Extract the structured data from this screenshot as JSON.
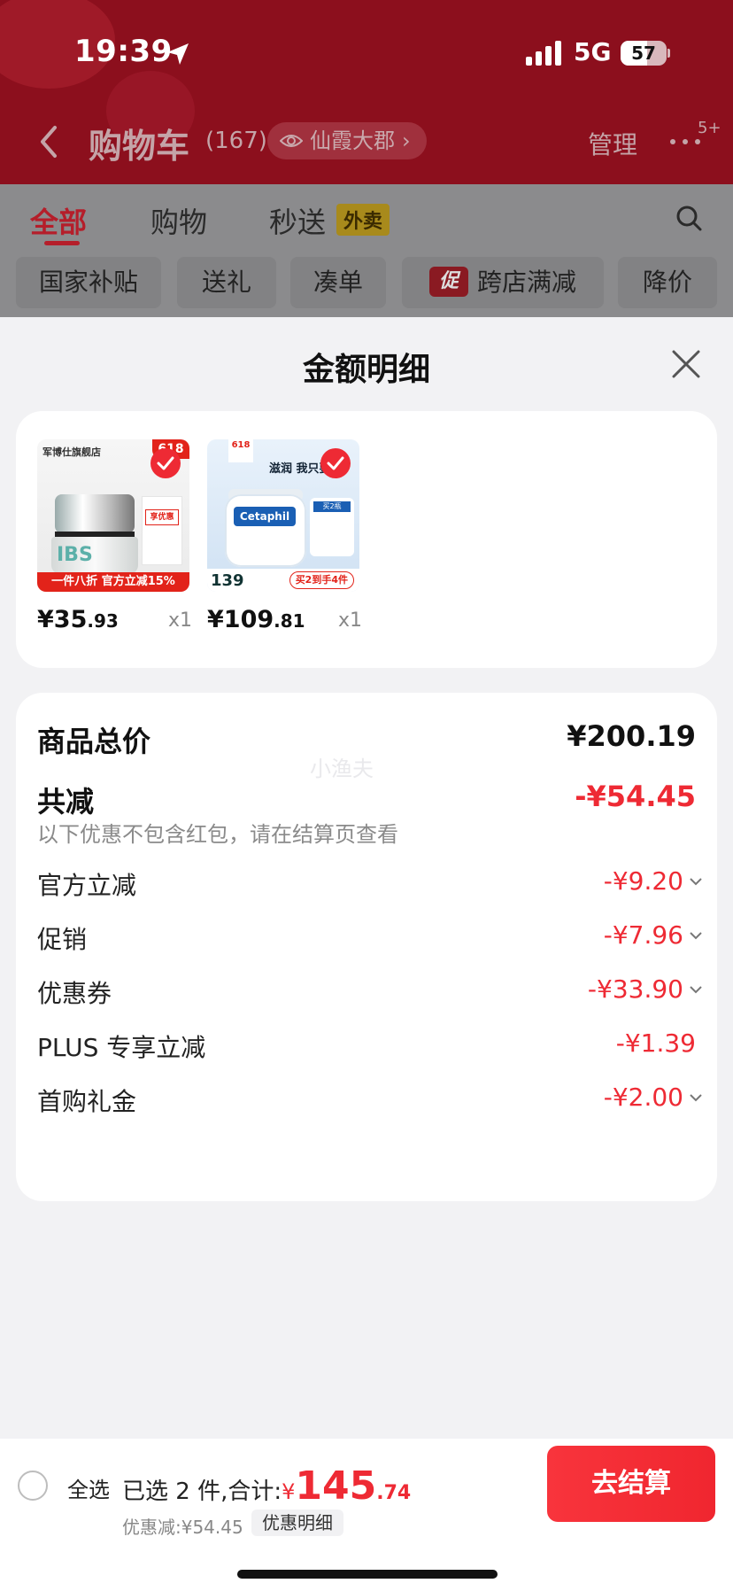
{
  "status_bar": {
    "time": "19:39",
    "network": "5G",
    "battery": "57"
  },
  "nav": {
    "title": "购物车",
    "count": "(167)",
    "address": "仙霞大郡",
    "manage": "管理",
    "badge": "5+"
  },
  "tabs": [
    {
      "label": "全部"
    },
    {
      "label": "购物"
    },
    {
      "label": "秒送"
    }
  ],
  "takeaway_badge": "外卖",
  "filter_chips": [
    {
      "label": "国家补贴"
    },
    {
      "label": "送礼"
    },
    {
      "label": "凑单"
    },
    {
      "label": "跨店满减",
      "icon_text": "促"
    },
    {
      "label": "降价"
    }
  ],
  "sheet": {
    "title": "金额明细",
    "products": [
      {
        "price_int": "¥35",
        "price_dec": ".93",
        "qty": "x1",
        "art": {
          "store": "军博仕旗舰店",
          "badge": "618",
          "box_text": "享优惠",
          "jar_logo": "IBS",
          "strip": "一件八折 官方立减15%"
        }
      },
      {
        "price_int": "¥109",
        "price_dec": ".81",
        "qty": "x1",
        "art": {
          "badge": "618",
          "headline": "滋润 我只要",
          "brand": "Cetaphil",
          "side_tag": "买2瓶",
          "price_tag": "139",
          "buy_tag": "买2到手4件"
        }
      }
    ],
    "details": {
      "total_label": "商品总价",
      "total_value": "¥200.19",
      "reduce_label": "共减",
      "reduce_value": "-¥54.45",
      "note": "以下优惠不包含红包，请在结算页查看",
      "watermark": "小渔夫",
      "items": [
        {
          "label": "官方立减",
          "value": "-¥9.20",
          "expandable": true
        },
        {
          "label": "促销",
          "value": "-¥7.96",
          "expandable": true
        },
        {
          "label": "优惠券",
          "value": "-¥33.90",
          "expandable": true
        },
        {
          "label": "PLUS 专享立减",
          "value": "-¥1.39",
          "expandable": false
        },
        {
          "label": "首购礼金",
          "value": "-¥2.00",
          "expandable": true
        }
      ]
    }
  },
  "bottom_bar": {
    "select_all": "全选",
    "selected_text": "已选 2 件,合计:",
    "total_yen": "¥",
    "total_int": "145",
    "total_dec": ".74",
    "discount": "优惠减:¥54.45",
    "detail_button": "优惠明细",
    "checkout": "去结算"
  },
  "colors": {
    "accent_red": "#ee2a34",
    "header_red": "#8c0f1d"
  }
}
